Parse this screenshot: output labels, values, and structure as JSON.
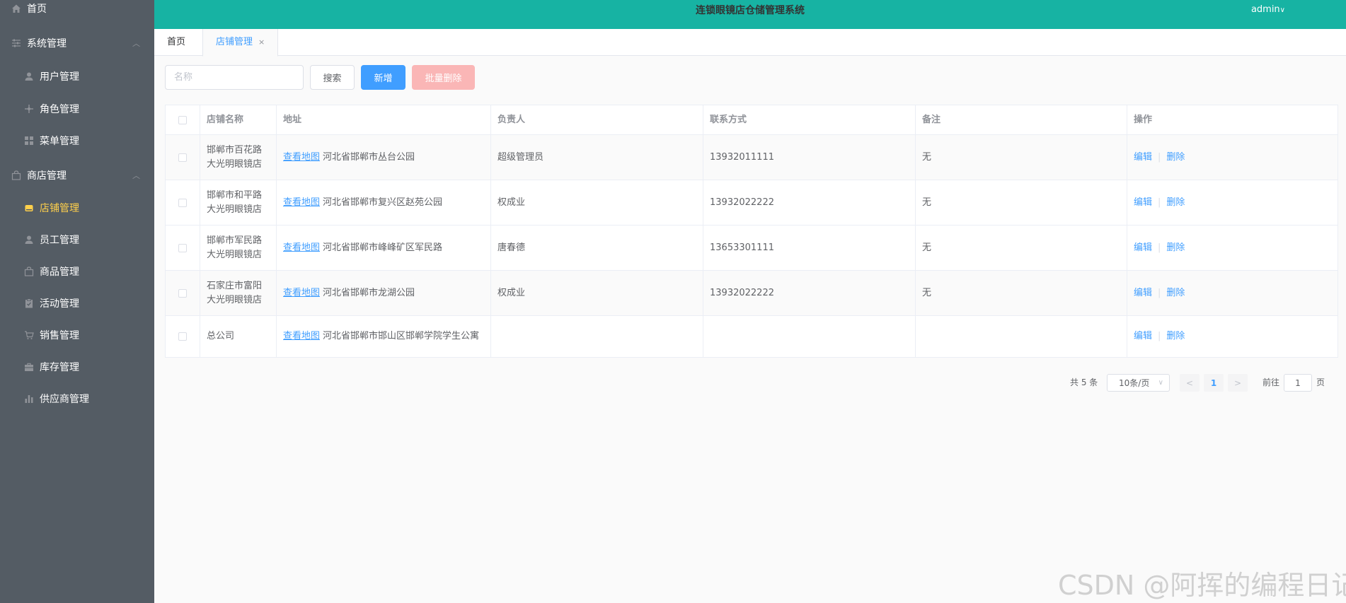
{
  "app": {
    "title": "连锁眼镜店仓储管理系统",
    "user": "admin"
  },
  "sidebar": {
    "home": "首页",
    "system": {
      "label": "系统管理",
      "items": [
        "用户管理",
        "角色管理",
        "菜单管理"
      ]
    },
    "store": {
      "label": "商店管理",
      "items": [
        "店铺管理",
        "员工管理",
        "商品管理",
        "活动管理",
        "销售管理",
        "库存管理",
        "供应商管理"
      ]
    }
  },
  "tabs": {
    "home": "首页",
    "current": "店铺管理"
  },
  "toolbar": {
    "search_placeholder": "名称",
    "search_label": "搜索",
    "add_label": "新增",
    "batch_delete_label": "批量删除"
  },
  "table": {
    "headers": [
      "店铺名称",
      "地址",
      "负责人",
      "联系方式",
      "备注",
      "操作"
    ],
    "map_link": "查看地图",
    "edit_label": "编辑",
    "delete_label": "删除",
    "rows": [
      {
        "name": "邯郸市百花路大光明眼镜店",
        "address": "河北省邯郸市丛台公园",
        "manager": "超级管理员",
        "phone": "13932011111",
        "remark": "无"
      },
      {
        "name": "邯郸市和平路大光明眼镜店",
        "address": "河北省邯郸市复兴区赵苑公园",
        "manager": "权成业",
        "phone": "13932022222",
        "remark": "无"
      },
      {
        "name": "邯郸市军民路大光明眼镜店",
        "address": "河北省邯郸市峰峰矿区军民路",
        "manager": "唐春德",
        "phone": "13653301111",
        "remark": "无"
      },
      {
        "name": "石家庄市富阳大光明眼镜店",
        "address": "河北省邯郸市龙湖公园",
        "manager": "权成业",
        "phone": "13932022222",
        "remark": "无"
      },
      {
        "name": "总公司",
        "address": "河北省邯郸市邯山区邯郸学院学生公寓",
        "manager": "",
        "phone": "",
        "remark": ""
      }
    ]
  },
  "pagination": {
    "total": "共 5 条",
    "page_size": "10条/页",
    "current_page": "1",
    "goto_prefix": "前往",
    "goto_value": "1",
    "goto_suffix": "页"
  },
  "watermark": "CSDN @阿挥的编程日记",
  "colors": {
    "sidebar_bg": "#545c64",
    "header_bg": "#17b3a3",
    "primary": "#409eff",
    "danger_disabled": "#fab6b6",
    "active_menu": "#ffd04b"
  }
}
